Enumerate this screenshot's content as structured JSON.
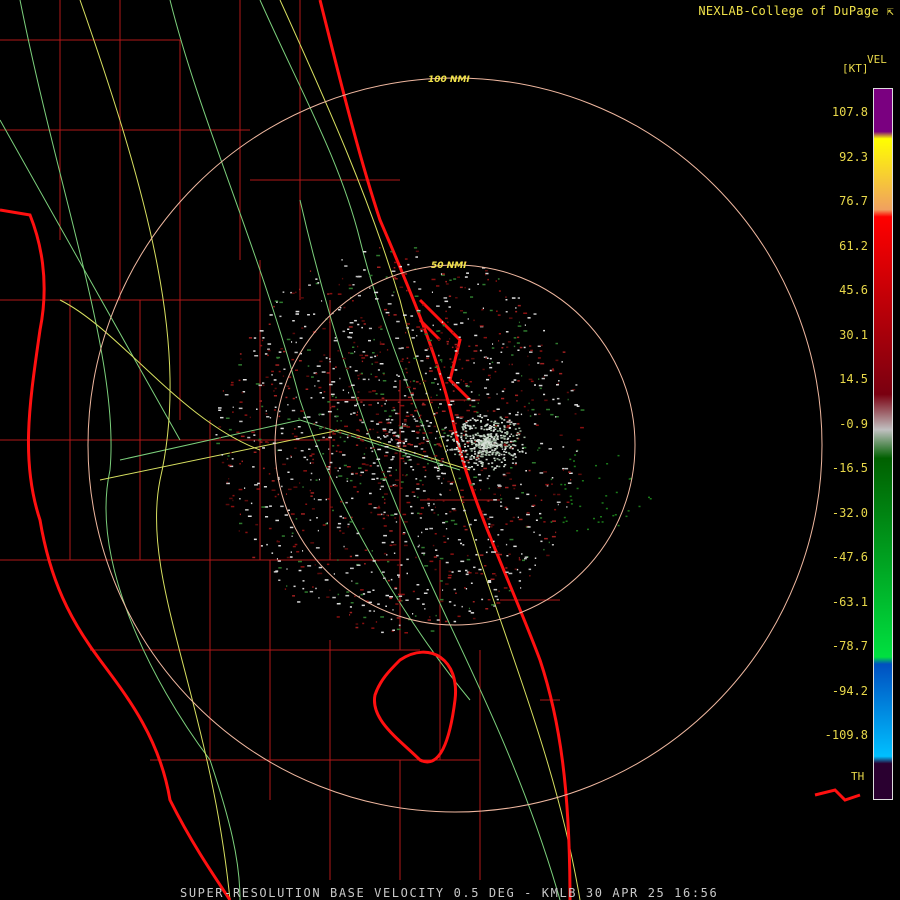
{
  "header": {
    "credit": "NEXLAB-College of DuPage",
    "credit_icon": "nexlab-logo-icon"
  },
  "footer": {
    "product_line": "SUPER-RESOLUTION BASE VELOCITY 0.5 DEG - KMLB 30 APR 25 16:56"
  },
  "map": {
    "rings": [
      {
        "label": "100 NMI"
      },
      {
        "label": "50 NMI"
      }
    ],
    "colors": {
      "state_lines": "#e01a1a",
      "roads": "#d8e060",
      "highways": "#80d080",
      "range_rings": "#f0b8a0",
      "background": "#000000"
    }
  },
  "legend": {
    "product": "VEL",
    "unit": "[KT]",
    "ticks": [
      "107.8",
      "92.3",
      "76.7",
      "61.2",
      "45.6",
      "30.1",
      "14.5",
      "-0.9",
      "-16.5",
      "-32.0",
      "-47.6",
      "-63.1",
      "-78.7",
      "-94.2",
      "-109.8"
    ],
    "th_label": "TH",
    "colors": [
      "#7a0080",
      "#ffff00",
      "#f0a060",
      "#ff0000",
      "#7a0010",
      "#c0c0c0",
      "#006000",
      "#00e040",
      "#0050c0",
      "#00c0ff",
      "#2a0030"
    ]
  }
}
